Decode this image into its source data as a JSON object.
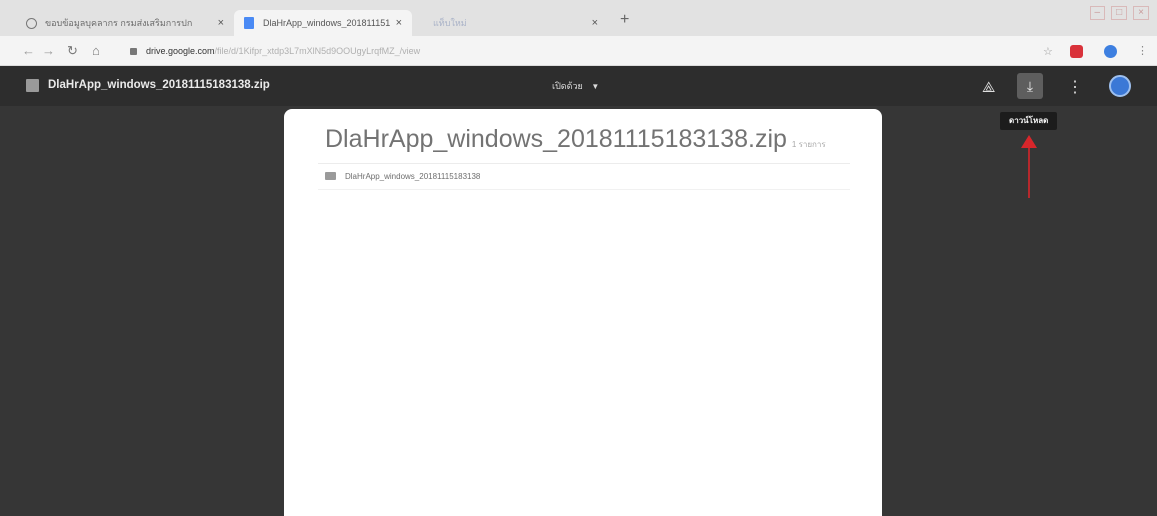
{
  "browser": {
    "tabs": [
      {
        "title": "ขอบข้อมูลบุคลากร กรมส่งเสริมการปก",
        "close": "×"
      },
      {
        "title": "DlaHrApp_windows_2018111515",
        "close": "×"
      },
      {
        "title": "แท็บใหม่",
        "close": "×"
      }
    ],
    "new_tab": "+",
    "url_domain": "drive.google.com",
    "url_path": "/file/d/1Kifpr_xtdp3L7mXlN5d9OOUgyLrqfMZ_/view"
  },
  "viewer": {
    "file_name": "DlaHrApp_windows_20181115183138.zip",
    "open_with_label": "เปิดด้วย",
    "download_tooltip": "ดาวน์โหลด"
  },
  "archive": {
    "title": "DlaHrApp_windows_20181115183138.zip",
    "item_count": "1 รายการ",
    "items": [
      {
        "name": "DlaHrApp_windows_20181115183138"
      }
    ]
  },
  "colors": {
    "viewer_background": "#363636",
    "annotation_arrow": "#d8262b"
  }
}
